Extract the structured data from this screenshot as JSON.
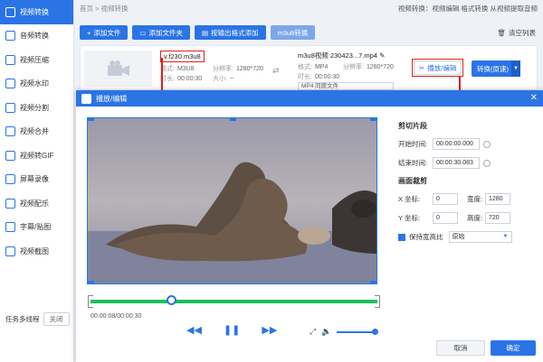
{
  "sidebar": {
    "items": [
      {
        "label": "视频转换",
        "icon": "video-convert-icon",
        "active": true
      },
      {
        "label": "音频转换",
        "icon": "audio-icon"
      },
      {
        "label": "视频压缩",
        "icon": "compress-icon"
      },
      {
        "label": "视频水印",
        "icon": "watermark-icon"
      },
      {
        "label": "视频分割",
        "icon": "split-icon"
      },
      {
        "label": "视频合并",
        "icon": "merge-icon"
      },
      {
        "label": "视频转GIF",
        "icon": "gif-icon"
      },
      {
        "label": "屏幕录像",
        "icon": "record-icon"
      },
      {
        "label": "视频配乐",
        "icon": "music-icon"
      },
      {
        "label": "字幕/贴图",
        "icon": "subtitle-icon"
      },
      {
        "label": "视频截图",
        "icon": "screenshot-icon"
      }
    ],
    "multitask_label": "任务多线程",
    "multitask_toggle": "关闭"
  },
  "breadcrumb": "首页 > 视频转换",
  "hint": "视频转换：视频编辑 格式转换 从视频提取音频",
  "toolbar": {
    "add_file": "添加文件",
    "add_folder": "添加文件夹",
    "add_by_format": "按输出格式添加",
    "m3u8": "m3u8转换",
    "clear": "清空列表"
  },
  "file": {
    "source_name": "v.f230.m3u8",
    "src_format_label": "格式:",
    "src_format": "M3U8",
    "src_res_label": "分辨率:",
    "src_res": "1280*720",
    "src_dur_label": "时长:",
    "src_dur": "00:00:30",
    "src_size_label": "大小:",
    "src_size": "--",
    "output_name": "m3u8视频 230423...7.mp4",
    "out_format_label": "格式:",
    "out_format": "MP4",
    "out_res_label": "分辨率:",
    "out_res": "1280*720",
    "out_dur_label": "时长:",
    "out_dur": "00:00:30",
    "format_select": "MP4  同原文件",
    "cut_edit": "播放/编辑",
    "convert": "转换(原速)"
  },
  "dialog": {
    "title": "播放/编辑",
    "time": "00:00:08/00:00:30",
    "clip_title": "剪切片段",
    "start_label": "开始时间:",
    "start_value": "00:00:00.000",
    "end_label": "结束时间:",
    "end_value": "00:00:30.083",
    "crop_title": "画面裁剪",
    "x_label": "X 坐标:",
    "x_value": "0",
    "width_label": "宽度:",
    "width_value": "1280",
    "y_label": "Y 坐标:",
    "y_value": "0",
    "height_label": "高度:",
    "height_value": "720",
    "ratio_label": "保持宽高比",
    "ratio_value": "原始",
    "cancel": "取消",
    "ok": "确定"
  },
  "colors": {
    "accent": "#2b74e6",
    "highlight": "#e0201c",
    "track": "#19c15a"
  }
}
